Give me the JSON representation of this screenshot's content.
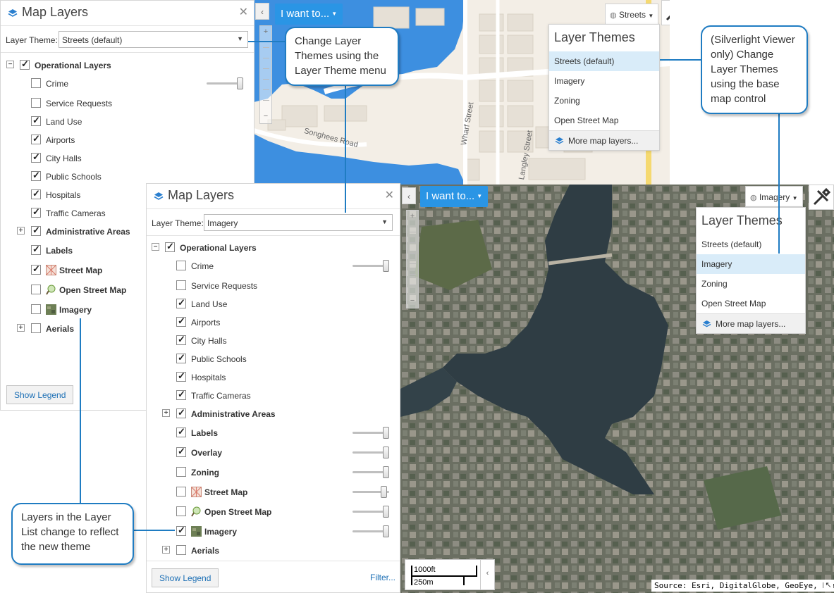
{
  "panel_streets": {
    "title": "Map Layers",
    "theme_label": "Layer Theme:",
    "theme_value": "Streets (default)",
    "layers": [
      {
        "label": "Operational Layers",
        "checked": true,
        "bold": true,
        "expander": "−"
      },
      {
        "label": "Crime",
        "checked": false,
        "bold": false
      },
      {
        "label": "Service Requests",
        "checked": false,
        "bold": false
      },
      {
        "label": "Land Use",
        "checked": true,
        "bold": false
      },
      {
        "label": "Airports",
        "checked": true,
        "bold": false
      },
      {
        "label": "City Halls",
        "checked": true,
        "bold": false
      },
      {
        "label": "Public Schools",
        "checked": true,
        "bold": false
      },
      {
        "label": "Hospitals",
        "checked": true,
        "bold": false
      },
      {
        "label": "Traffic Cameras",
        "checked": true,
        "bold": false
      },
      {
        "label": "Administrative Areas",
        "checked": true,
        "bold": true,
        "expander": "+"
      },
      {
        "label": "Labels",
        "checked": true,
        "bold": true
      },
      {
        "label": "Street Map",
        "checked": true,
        "bold": true,
        "icon": "street-map-icon"
      },
      {
        "label": "Open Street Map",
        "checked": false,
        "bold": true,
        "icon": "open-street-map-icon"
      },
      {
        "label": "Imagery",
        "checked": false,
        "bold": true,
        "icon": "imagery-icon"
      },
      {
        "label": "Aerials",
        "checked": false,
        "bold": true,
        "expander": "+"
      }
    ],
    "show_legend": "Show Legend"
  },
  "panel_imagery": {
    "title": "Map Layers",
    "theme_label": "Layer Theme:",
    "theme_value": "Imagery",
    "layers": [
      {
        "label": "Operational Layers",
        "checked": true,
        "bold": true,
        "expander": "−"
      },
      {
        "label": "Crime",
        "checked": false,
        "bold": false
      },
      {
        "label": "Service Requests",
        "checked": false,
        "bold": false
      },
      {
        "label": "Land Use",
        "checked": true,
        "bold": false
      },
      {
        "label": "Airports",
        "checked": true,
        "bold": false
      },
      {
        "label": "City Halls",
        "checked": true,
        "bold": false
      },
      {
        "label": "Public Schools",
        "checked": true,
        "bold": false
      },
      {
        "label": "Hospitals",
        "checked": true,
        "bold": false
      },
      {
        "label": "Traffic Cameras",
        "checked": true,
        "bold": false
      },
      {
        "label": "Administrative Areas",
        "checked": true,
        "bold": true,
        "expander": "+"
      },
      {
        "label": "Labels",
        "checked": true,
        "bold": true
      },
      {
        "label": "Overlay",
        "checked": true,
        "bold": true
      },
      {
        "label": "Zoning",
        "checked": false,
        "bold": true
      },
      {
        "label": "Street Map",
        "checked": false,
        "bold": true,
        "icon": "street-map-icon"
      },
      {
        "label": "Open Street Map",
        "checked": false,
        "bold": true,
        "icon": "open-street-map-icon"
      },
      {
        "label": "Imagery",
        "checked": true,
        "bold": true,
        "icon": "imagery-icon"
      },
      {
        "label": "Aerials",
        "checked": false,
        "bold": true,
        "expander": "+"
      }
    ],
    "show_legend": "Show Legend",
    "filter": "Filter..."
  },
  "map_streets": {
    "i_want_to": "I want to...",
    "basemap": "Streets",
    "map_labels": [
      "Songhees Road",
      "Wharf Street",
      "Langley Street"
    ],
    "menu": {
      "title": "Layer Themes",
      "items": [
        "Streets (default)",
        "Imagery",
        "Zoning",
        "Open Street Map"
      ],
      "selected": "Streets (default)",
      "more": "More map layers..."
    }
  },
  "map_imagery": {
    "i_want_to": "I want to...",
    "basemap": "Imagery",
    "menu": {
      "title": "Layer Themes",
      "items": [
        "Streets (default)",
        "Imagery",
        "Zoning",
        "Open Street Map"
      ],
      "selected": "Imagery",
      "more": "More map layers..."
    },
    "scale_top": "1000ft",
    "scale_bottom": "250m",
    "source": "Source: Esri, DigitalGlobe, GeoEye, Earths"
  },
  "callouts": {
    "layer_theme_menu": "Change Layer Themes using the Layer Theme menu",
    "silverlight": "(Silverlight Viewer only) Change Layer Themes using the base map control",
    "layer_list": "Layers in the Layer List change to reflect the new theme"
  },
  "colors": {
    "accent": "#2a95e5",
    "callout_border": "#1f7cc2",
    "water": "#3d8fe0",
    "menu_selected": "#d9ecf9"
  }
}
